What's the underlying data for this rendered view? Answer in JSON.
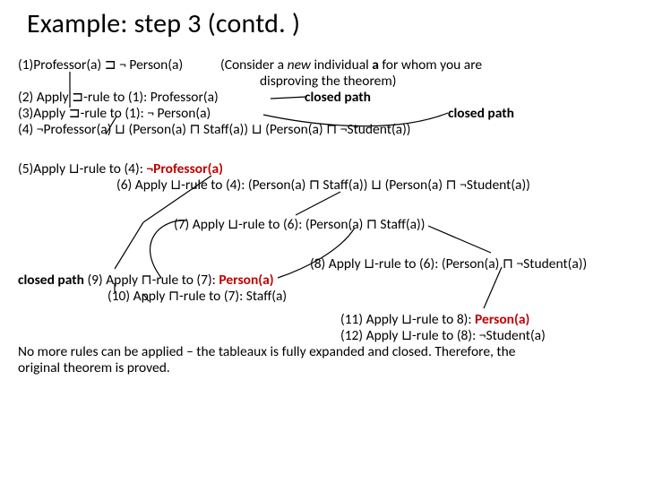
{
  "title": "Example: step 3  (contd. )",
  "lines": {
    "l1a": "(1)Professor(a)  ⊐ ¬ Person(a)",
    "l1b_pre": "(Consider a ",
    "l1b_new": "new",
    "l1b_mid": " individual ",
    "l1b_a": "a",
    "l1b_post": " for whom you are",
    "l1c": "disproving the theorem)",
    "l2a": "(2)  Apply  ⊐-rule to (1):    Professor(a)",
    "l2b": "closed path",
    "l3a": "(3)Apply ⊐-rule to (1):     ¬ Person(a)",
    "l3b": "closed path",
    "l4": "(4) ¬Professor(a) ⊔ (Person(a) ⊓ Staff(a)) ⊔ (Person(a) ⊓ ¬Student(a))",
    "l5a": "(5)Apply ⊔-rule to (4):   ",
    "l5b": "¬Professor(a)",
    "l6": "(6) Apply ⊔-rule to (4):  (Person(a) ⊓ Staff(a)) ⊔ (Person(a) ⊓ ¬Student(a))",
    "l7": "(7) Apply ⊔-rule to (6):  (Person(a) ⊓ Staff(a))",
    "l8": "(8) Apply ⊔-rule to (6): (Person(a) ⊓ ¬Student(a))",
    "l9cp": "closed path",
    "l9": "   (9) Apply ⊓-rule to (7): ",
    "l9b": "Person(a)",
    "l10": "(10) Apply ⊓-rule to (7): Staff(a)",
    "l11a": "(11) Apply ⊔-rule to  8):  ",
    "l11b": "Person(a)",
    "l12": "(12) Apply ⊔-rule to (8):  ¬Student(a)",
    "concl1": "No more rules can be applied – the tableaux is fully expanded and closed. Therefore, the",
    "concl2": "original theorem is proved."
  }
}
